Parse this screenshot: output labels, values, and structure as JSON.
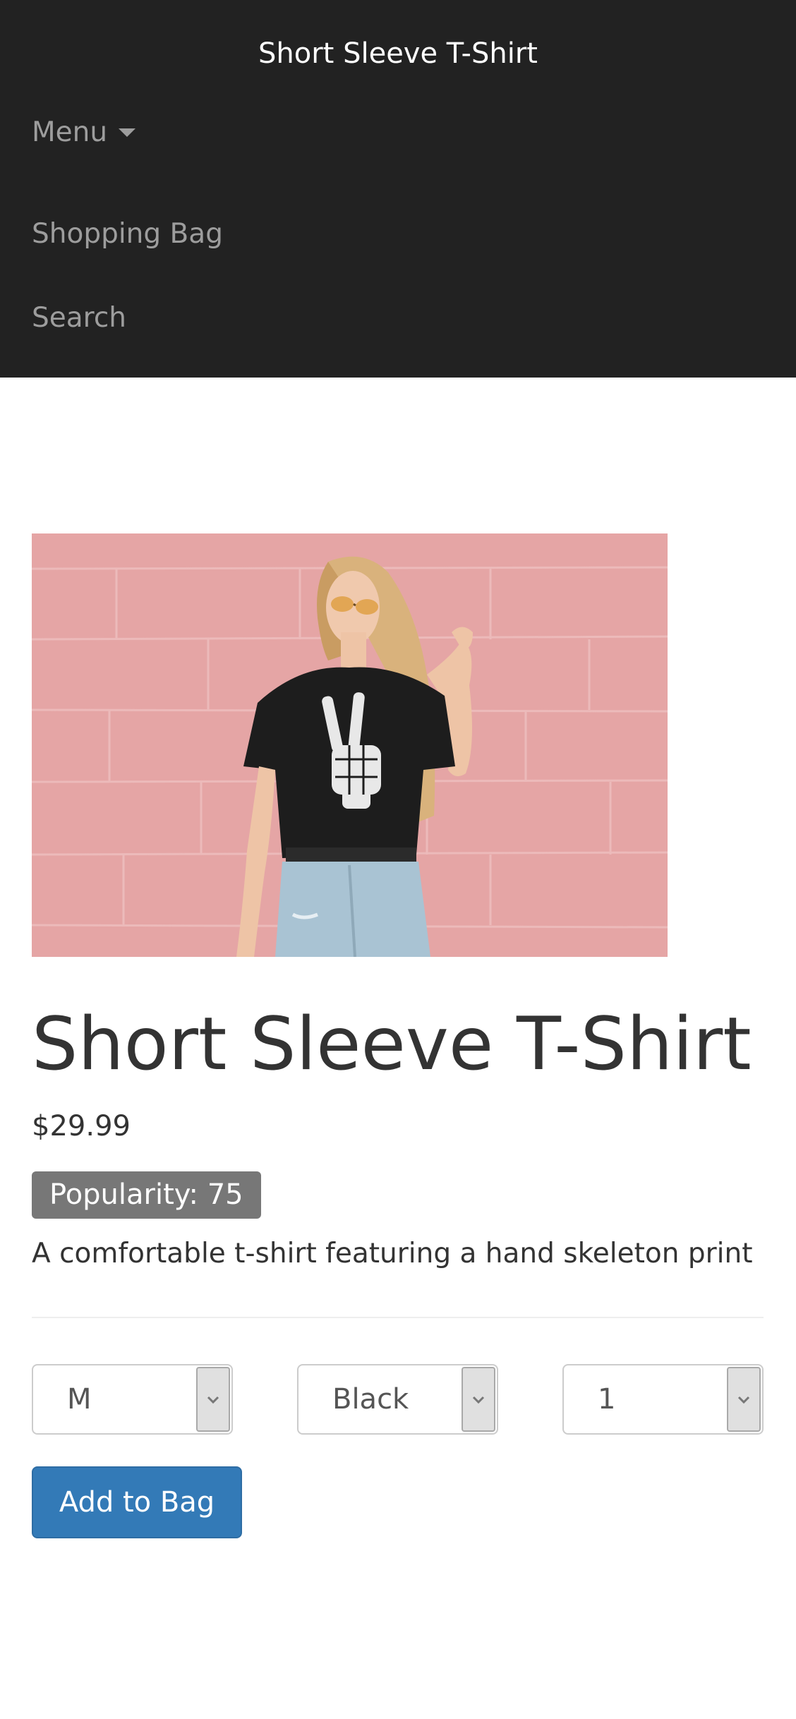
{
  "navbar": {
    "brand": "Short Sleeve T-Shirt",
    "menu_label": "Menu",
    "shopping_bag_label": "Shopping Bag",
    "search_label": "Search"
  },
  "product": {
    "image_icon": "product-photo",
    "title": "Short Sleeve T-Shirt",
    "price": "$29.99",
    "popularity_label": "Popularity: 75",
    "description": "A comfortable t-shirt featuring a hand skeleton print"
  },
  "options": {
    "size_value": "M",
    "color_value": "Black",
    "quantity_value": "1"
  },
  "actions": {
    "add_to_bag_label": "Add to Bag"
  },
  "colors": {
    "navbar_bg": "#222222",
    "nav_link": "#9d9d9d",
    "badge_bg": "#777777",
    "primary_button": "#337ab7",
    "image_wall": "#e8a7a7"
  }
}
